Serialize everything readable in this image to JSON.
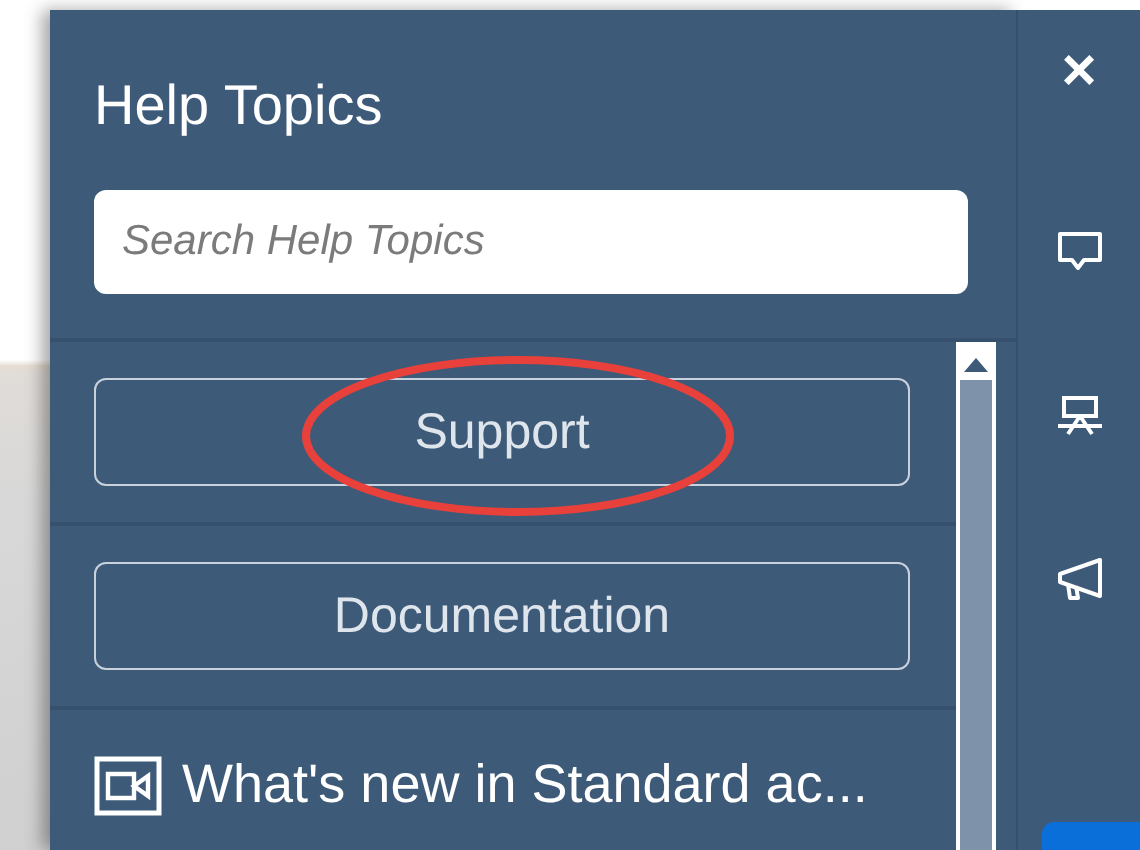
{
  "panel": {
    "title": "Help Topics",
    "search": {
      "placeholder": "Search Help Topics"
    },
    "buttons": [
      {
        "label": "Support",
        "circled": true
      },
      {
        "label": "Documentation",
        "circled": false
      }
    ],
    "topics": [
      {
        "kind": "video",
        "label": "What's new in Standard ac..."
      }
    ]
  },
  "rail": {
    "items": [
      {
        "kind": "close",
        "glyph": "×"
      },
      {
        "kind": "chat"
      },
      {
        "kind": "presentation"
      },
      {
        "kind": "megaphone"
      }
    ]
  }
}
